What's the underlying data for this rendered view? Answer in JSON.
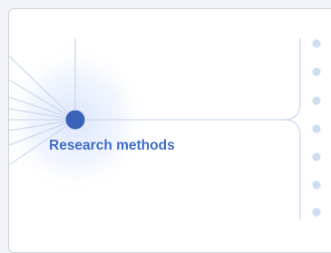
{
  "diagram": {
    "node_label": "Research methods",
    "node_color": "#3a63b8",
    "label_color": "#3f6ec8",
    "line_color": "#cdd9f0",
    "dot_color": "#cfdcf2",
    "glow_color": "#dbe6fb"
  }
}
